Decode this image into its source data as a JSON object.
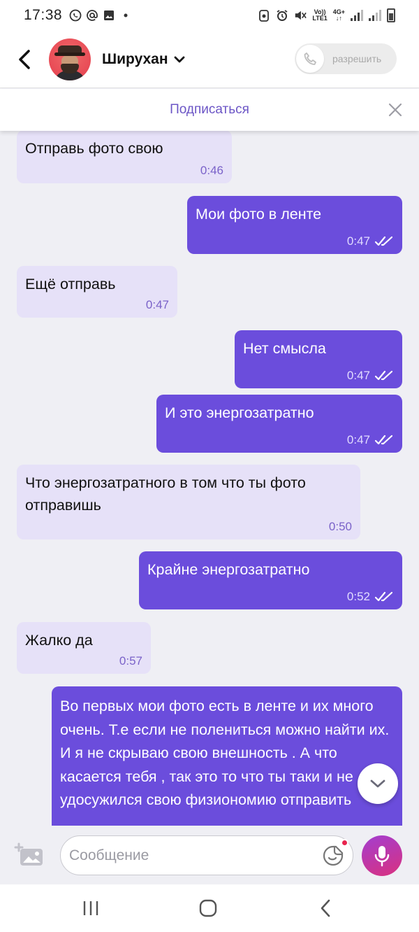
{
  "status_bar": {
    "time": "17:38",
    "network_label_1": "Vo))",
    "network_label_2": "LTE1",
    "network_label_3": "4G+"
  },
  "header": {
    "contact_name": "Ширухан",
    "call_button_label": "разрешить"
  },
  "subscribe_bar": {
    "label": "Подписаться"
  },
  "messages": [
    {
      "direction": "in",
      "text": "Отправь фото свою",
      "time": "0:46"
    },
    {
      "direction": "out",
      "text": "Мои фото в ленте",
      "time": "0:47"
    },
    {
      "direction": "in",
      "text": "Ещё отправь",
      "time": "0:47"
    },
    {
      "direction": "out",
      "text": "Нет смысла",
      "time": "0:47"
    },
    {
      "direction": "out",
      "text": "И это энергозатратно",
      "time": "0:47"
    },
    {
      "direction": "in",
      "text": "Что энергозатратного в том что ты фото отправишь",
      "time": "0:50"
    },
    {
      "direction": "out",
      "text": "Крайне энергозатратно",
      "time": "0:52"
    },
    {
      "direction": "in",
      "text": "Жалко да",
      "time": "0:57"
    },
    {
      "direction": "out",
      "text": "Во первых мои фото есть в ленте и их много очень. Т.е если не полениться можно найти их. И я не скрываю свою внешность . А что касается тебя , так это то что ты таки и не удосужился свою физиономию отправить",
      "time": ""
    }
  ],
  "composer": {
    "placeholder": "Сообщение"
  },
  "colors": {
    "accent": "#6b4ddc",
    "incoming_bubble": "#e6e1f8",
    "subscribe_link": "#6c56c6",
    "mic_gradient_start": "#a33ed0",
    "mic_gradient_end": "#d9317f"
  }
}
